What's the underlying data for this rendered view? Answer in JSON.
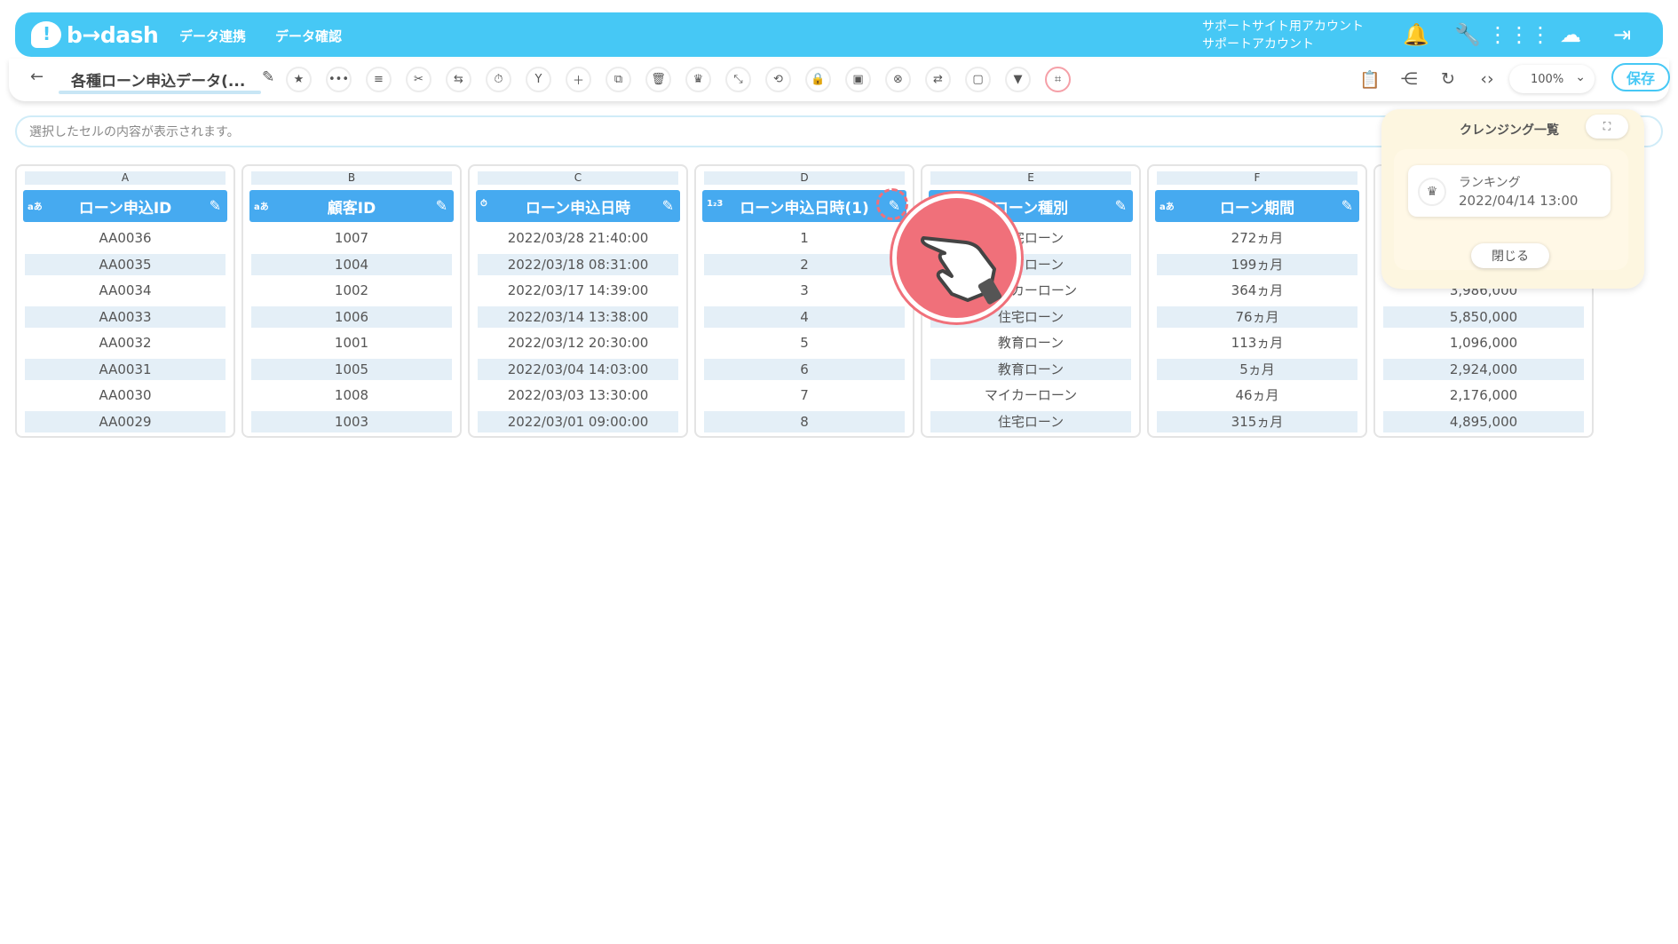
{
  "app": {
    "logo_text": "b→dash"
  },
  "topnav": [
    "データ連携",
    "データ確認"
  ],
  "account": {
    "line1": "サポートサイト用アカウント",
    "line2": "サポートアカウント"
  },
  "toolbar": {
    "title": "各種ローン申込データ(...",
    "zoom": "100%",
    "save_label": "保存"
  },
  "cellbar": {
    "placeholder": "選択したセルの内容が表示されます。"
  },
  "columns": [
    {
      "letter": "A",
      "type": "aあ",
      "name": "ローン申込ID",
      "values": [
        "AA0036",
        "AA0035",
        "AA0034",
        "AA0033",
        "AA0032",
        "AA0031",
        "AA0030",
        "AA0029"
      ]
    },
    {
      "letter": "B",
      "type": "aあ",
      "name": "顧客ID",
      "values": [
        "1007",
        "1004",
        "1002",
        "1006",
        "1001",
        "1005",
        "1008",
        "1003"
      ]
    },
    {
      "letter": "C",
      "type": "⏱",
      "name": "ローン申込日時",
      "values": [
        "2022/03/28 21:40:00",
        "2022/03/18 08:31:00",
        "2022/03/17 14:39:00",
        "2022/03/14 13:38:00",
        "2022/03/12 20:30:00",
        "2022/03/04 14:03:00",
        "2022/03/03 13:30:00",
        "2022/03/01 09:00:00"
      ]
    },
    {
      "letter": "D",
      "type": "1₂3",
      "name": "ローン申込日時(1)",
      "values": [
        "1",
        "2",
        "3",
        "4",
        "5",
        "6",
        "7",
        "8"
      ]
    },
    {
      "letter": "E",
      "type": "aあ",
      "name": "ローン種別",
      "values": [
        "住宅ローン",
        "教育ローン",
        "マイカーローン",
        "住宅ローン",
        "教育ローン",
        "教育ローン",
        "マイカーローン",
        "住宅ローン"
      ]
    },
    {
      "letter": "F",
      "type": "aあ",
      "name": "ローン期間",
      "values": [
        "272ヵ月",
        "199ヵ月",
        "364ヵ月",
        "76ヵ月",
        "113ヵ月",
        "5ヵ月",
        "46ヵ月",
        "315ヵ月"
      ]
    },
    {
      "letter": "",
      "type": "",
      "name": "",
      "values": [
        "",
        "",
        "3,986,000",
        "5,850,000",
        "1,096,000",
        "2,924,000",
        "2,176,000",
        "4,895,000"
      ]
    }
  ],
  "cleansing_panel": {
    "title": "クレンジング一覧",
    "item_name": "ランキング",
    "item_date": "2022/04/14 13:00",
    "close_label": "閉じる"
  }
}
